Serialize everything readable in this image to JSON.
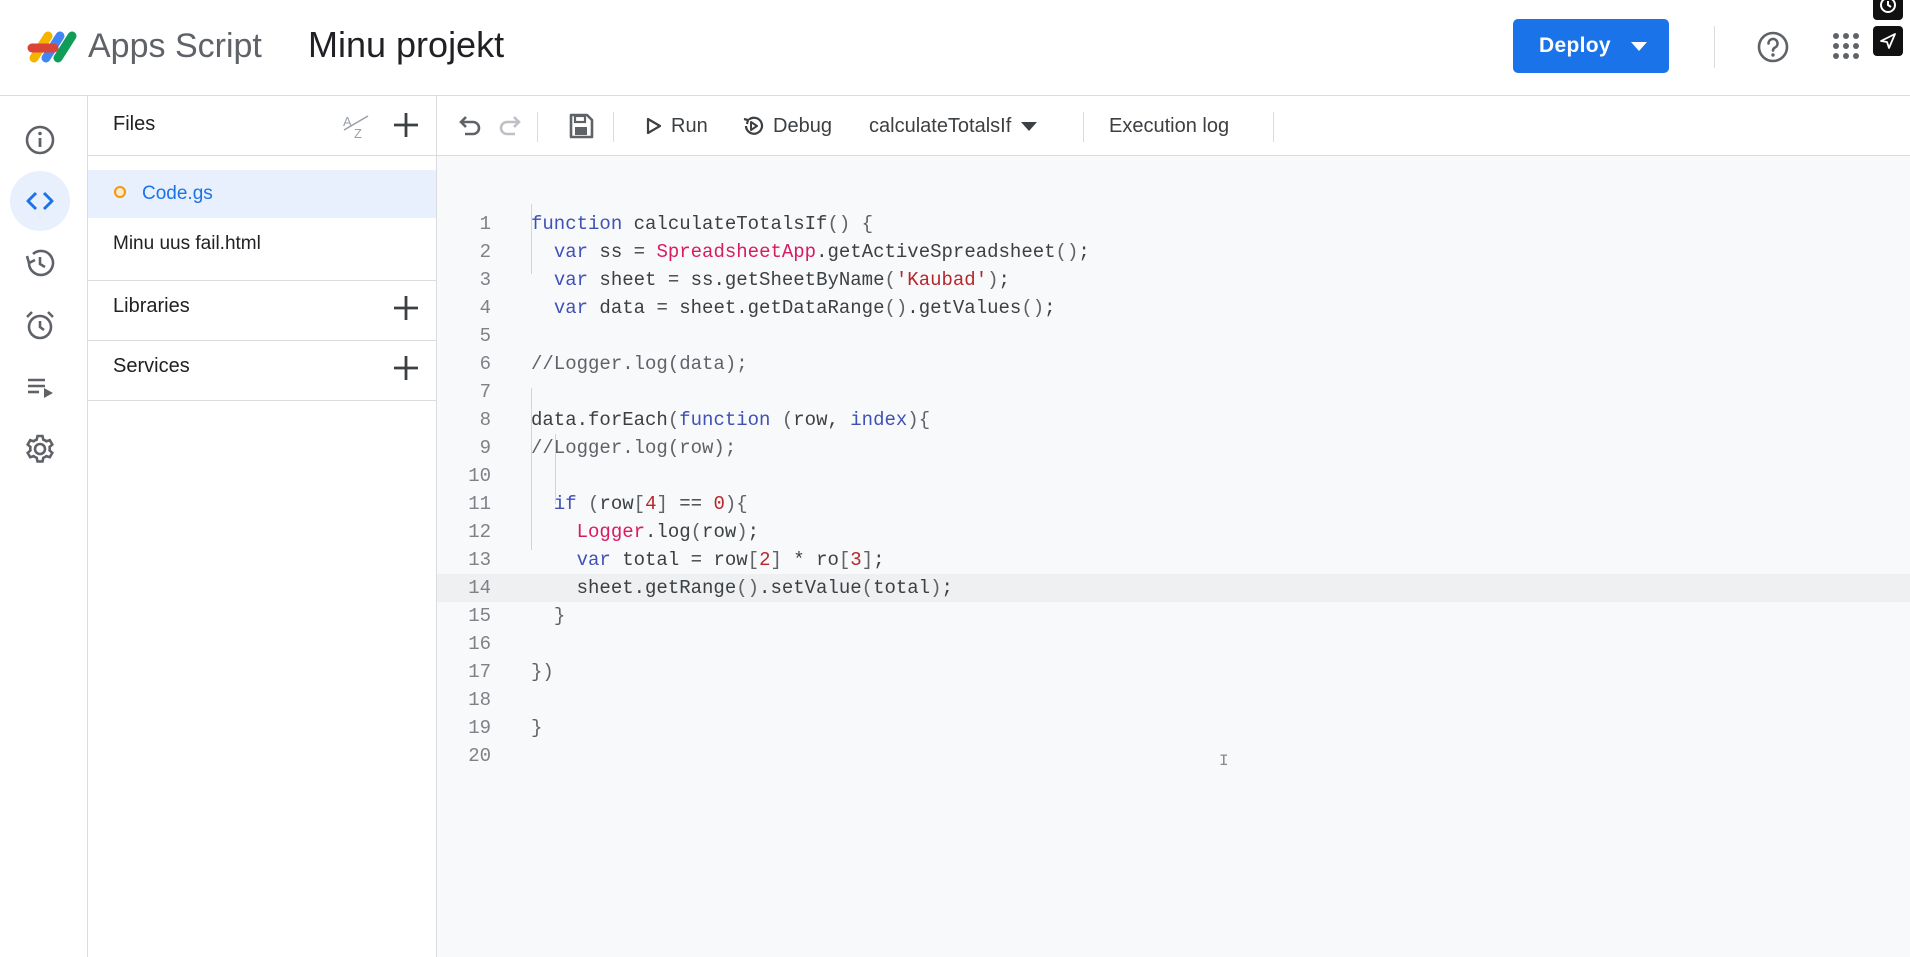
{
  "header": {
    "product_name": "Apps Script",
    "project_title": "Minu projekt",
    "deploy_label": "Deploy",
    "icons": [
      "apps-script-logo-icon",
      "help-icon",
      "apps-grid-icon",
      "history-corner-icon",
      "send-corner-icon"
    ]
  },
  "rail": {
    "items": [
      {
        "name": "overview",
        "icon": "info-icon"
      },
      {
        "name": "editor",
        "icon": "code-icon",
        "active": true
      },
      {
        "name": "history",
        "icon": "history-icon"
      },
      {
        "name": "triggers",
        "icon": "alarm-icon"
      },
      {
        "name": "executions",
        "icon": "executions-icon"
      },
      {
        "name": "settings",
        "icon": "gear-icon"
      }
    ]
  },
  "files_panel": {
    "files_header": "Files",
    "files": [
      {
        "name": "Code.gs",
        "selected": true
      },
      {
        "name": "Minu uus fail.html",
        "selected": false
      }
    ],
    "libraries_label": "Libraries",
    "services_label": "Services"
  },
  "toolbar": {
    "run_label": "Run",
    "debug_label": "Debug",
    "function_selected": "calculateTotalsIf",
    "execution_log_label": "Execution log"
  },
  "editor": {
    "current_line": 14,
    "lines": [
      {
        "n": "1",
        "text": "function calculateTotalsIf() {"
      },
      {
        "n": "2",
        "text": "  var ss = SpreadsheetApp.getActiveSpreadsheet();"
      },
      {
        "n": "3",
        "text": "  var sheet = ss.getSheetByName('Kaubad');"
      },
      {
        "n": "4",
        "text": "  var data = sheet.getDataRange().getValues();"
      },
      {
        "n": "5",
        "text": ""
      },
      {
        "n": "6",
        "text": "//Logger.log(data);"
      },
      {
        "n": "7",
        "text": ""
      },
      {
        "n": "8",
        "text": "data.forEach(function (row, index){"
      },
      {
        "n": "9",
        "text": "//Logger.log(row);"
      },
      {
        "n": "10",
        "text": ""
      },
      {
        "n": "11",
        "text": "  if (row[4] == 0){"
      },
      {
        "n": "12",
        "text": "    Logger.log(row);"
      },
      {
        "n": "13",
        "text": "    var total = row[2] * ro[3];"
      },
      {
        "n": "14",
        "text": "    sheet.getRange().setValue(total);"
      },
      {
        "n": "15",
        "text": "  }"
      },
      {
        "n": "16",
        "text": ""
      },
      {
        "n": "17",
        "text": "})"
      },
      {
        "n": "18",
        "text": ""
      },
      {
        "n": "19",
        "text": "}"
      },
      {
        "n": "20",
        "text": ""
      }
    ]
  },
  "colors": {
    "accent": "#1a73e8",
    "keyword": "#3f51b5",
    "class_name": "#d81b60",
    "string": "#b5272d",
    "file_dot": "#f29900"
  }
}
